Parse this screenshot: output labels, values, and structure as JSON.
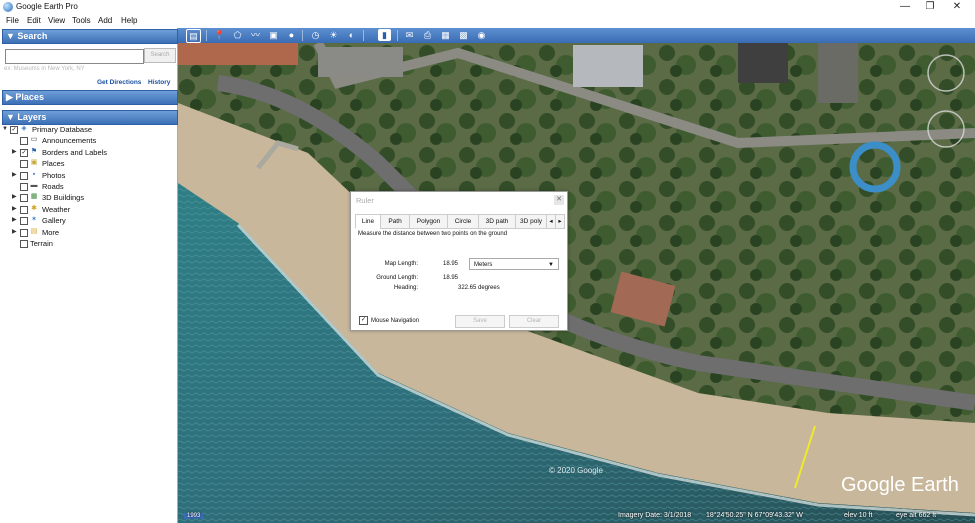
{
  "window": {
    "title": "Google Earth Pro",
    "controls": [
      "—",
      "❐",
      "✕"
    ]
  },
  "menu": [
    {
      "label": "File"
    },
    {
      "label": "Edit"
    },
    {
      "label": "View"
    },
    {
      "label": "Tools"
    },
    {
      "label": "Add"
    },
    {
      "label": "Help"
    }
  ],
  "search": {
    "header": "▼ Search",
    "placeholder": "",
    "button": "Search",
    "hint": "ex: Museums in New York, NY",
    "links": {
      "directions": "Get Directions",
      "history": "History"
    }
  },
  "places": {
    "header": "▶ Places"
  },
  "layers": {
    "header": "▼ Layers",
    "items": [
      {
        "label": "Primary Database",
        "checked": true,
        "expander": "▼"
      },
      {
        "label": "Announcements",
        "checked": false,
        "expander": ""
      },
      {
        "label": "Borders and Labels",
        "checked": true,
        "expander": "▶"
      },
      {
        "label": "Places",
        "checked": false,
        "expander": ""
      },
      {
        "label": "Photos",
        "checked": false,
        "expander": "▶"
      },
      {
        "label": "Roads",
        "checked": false,
        "expander": ""
      },
      {
        "label": "3D Buildings",
        "checked": false,
        "expander": "▶"
      },
      {
        "label": "Weather",
        "checked": false,
        "expander": "▶"
      },
      {
        "label": "Gallery",
        "checked": false,
        "expander": "▶"
      },
      {
        "label": "More",
        "checked": false,
        "expander": "▶"
      },
      {
        "label": "Terrain",
        "checked": false,
        "expander": ""
      }
    ]
  },
  "ruler": {
    "title": "Ruler",
    "tabs": [
      "Line",
      "Path",
      "Polygon",
      "Circle",
      "3D path",
      "3D poly"
    ],
    "active_tab": "Line",
    "description": "Measure the distance between two points on the ground",
    "map_length_label": "Map Length:",
    "map_length_value": "18.95",
    "units": "Meters",
    "ground_length_label": "Ground Length:",
    "ground_length_value": "18.95",
    "heading_label": "Heading:",
    "heading_value": "322.65 degrees",
    "mouse_nav_label": "Mouse Navigation",
    "mouse_nav_checked": true,
    "save_label": "Save",
    "clear_label": "Clear"
  },
  "map": {
    "copyright": "© 2020 Google",
    "brand": "Google Earth",
    "scale_label": "1993"
  },
  "status": {
    "imagery_date": "Imagery Date: 3/1/2018",
    "coords": "18°24'50.25\" N   67°09'43.32\" W",
    "elev": "elev  10 ft",
    "eye_alt": "eye alt  662 ft"
  }
}
